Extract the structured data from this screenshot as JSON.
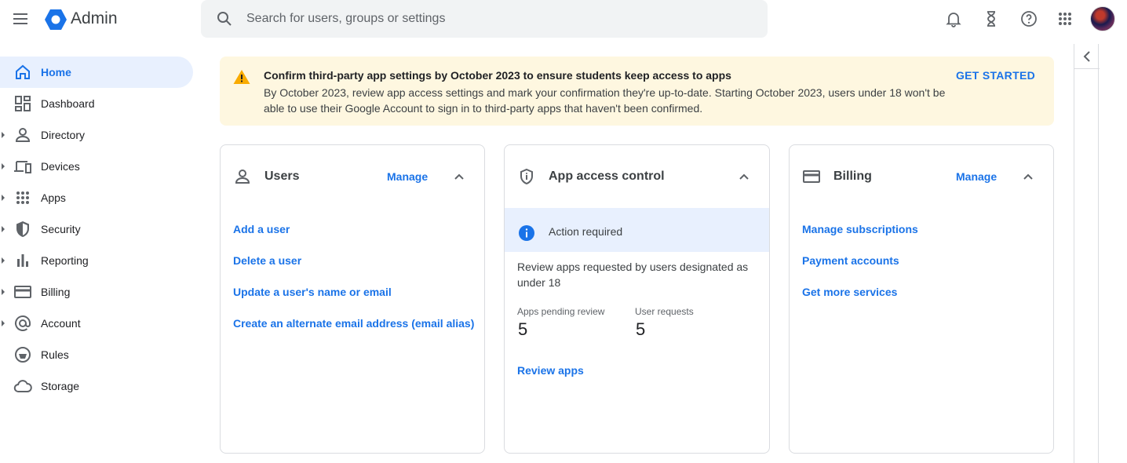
{
  "header": {
    "app_name": "Admin",
    "search_placeholder": "Search for users, groups or settings",
    "icons": [
      "menu-icon",
      "admin-logo-icon",
      "search-icon",
      "bell-icon",
      "hourglass-icon",
      "help-icon",
      "apps-grid-icon",
      "avatar"
    ]
  },
  "sidebar": {
    "items": [
      {
        "label": "Home",
        "icon": "home-icon",
        "active": true,
        "expandable": false
      },
      {
        "label": "Dashboard",
        "icon": "dashboard-icon",
        "active": false,
        "expandable": false
      },
      {
        "label": "Directory",
        "icon": "person-icon",
        "active": false,
        "expandable": true
      },
      {
        "label": "Devices",
        "icon": "devices-icon",
        "active": false,
        "expandable": true
      },
      {
        "label": "Apps",
        "icon": "apps-grid-icon",
        "active": false,
        "expandable": true
      },
      {
        "label": "Security",
        "icon": "shield-icon",
        "active": false,
        "expandable": true
      },
      {
        "label": "Reporting",
        "icon": "bar-chart-icon",
        "active": false,
        "expandable": true
      },
      {
        "label": "Billing",
        "icon": "credit-card-icon",
        "active": false,
        "expandable": true
      },
      {
        "label": "Account",
        "icon": "at-sign-icon",
        "active": false,
        "expandable": true
      },
      {
        "label": "Rules",
        "icon": "rules-icon",
        "active": false,
        "expandable": false
      },
      {
        "label": "Storage",
        "icon": "cloud-icon",
        "active": false,
        "expandable": false
      }
    ]
  },
  "banner": {
    "title": "Confirm third-party app settings by October 2023 to ensure students keep access to apps",
    "text": "By October 2023, review app access settings and mark your confirmation they're up-to-date. Starting October 2023, users under 18 won't be able to use their Google Account to sign in to third-party apps that haven't been confirmed.",
    "action": "GET STARTED"
  },
  "cards": {
    "users": {
      "title": "Users",
      "manage": "Manage",
      "links": [
        "Add a user",
        "Delete a user",
        "Update a user's name or email",
        "Create an alternate email address (email alias)"
      ]
    },
    "app_access": {
      "title": "App access control",
      "action_required": "Action required",
      "description": "Review apps requested by users designated as under 18",
      "stat1_label": "Apps pending review",
      "stat1_value": "5",
      "stat2_label": "User requests",
      "stat2_value": "5",
      "link": "Review apps"
    },
    "billing": {
      "title": "Billing",
      "manage": "Manage",
      "links": [
        "Manage subscriptions",
        "Payment accounts",
        "Get more services"
      ]
    }
  },
  "colors": {
    "accent": "#1a73e8",
    "active_bg": "#e8f0fe",
    "banner_bg": "#fef7e0",
    "warning": "#f9ab00"
  }
}
